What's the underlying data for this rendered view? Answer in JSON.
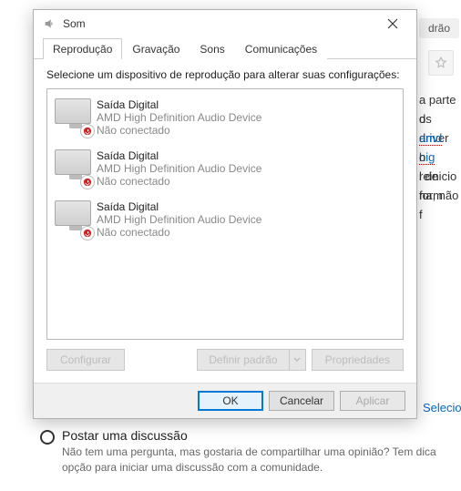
{
  "background": {
    "pill_text": "drão",
    "line1": "a parte d",
    "line2": "os driver",
    "line3_pre": "",
    "line3_link": "amd hig",
    "line4": "o reinicio",
    "line5": "de  form",
    "line6": "na, não f",
    "sidenote": "l",
    "selectione": "Selecione",
    "radio_title": "Postar uma discussão",
    "radio_desc": "Não tem uma pergunta, mas gostaria de compartilhar uma opinião? Tem dica opção para iniciar uma discussão com a comunidade."
  },
  "dialog": {
    "title": "Som",
    "tabs": [
      "Reprodução",
      "Gravação",
      "Sons",
      "Comunicações"
    ],
    "active_tab": 0,
    "instruction": "Selecione um dispositivo de reprodução para alterar suas configurações:",
    "devices": [
      {
        "name": "Saída Digital",
        "sub": "AMD High Definition Audio Device",
        "status": "Não conectado"
      },
      {
        "name": "Saída Digital",
        "sub": "AMD High Definition Audio Device",
        "status": "Não conectado"
      },
      {
        "name": "Saída Digital",
        "sub": "AMD High Definition Audio Device",
        "status": "Não conectado"
      }
    ],
    "buttons": {
      "configure": "Configurar",
      "set_default": "Definir padrão",
      "properties": "Propriedades",
      "ok": "OK",
      "cancel": "Cancelar",
      "apply": "Aplicar"
    }
  }
}
